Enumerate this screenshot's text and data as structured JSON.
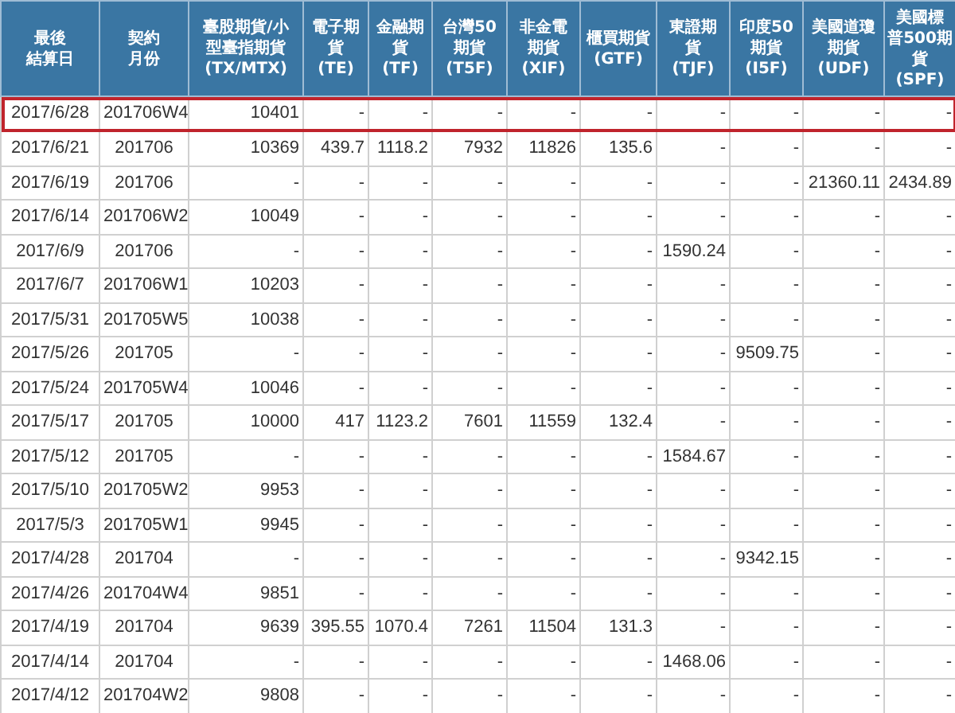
{
  "table": {
    "columns": [
      {
        "lines": [
          "最後",
          "結算日"
        ]
      },
      {
        "lines": [
          "契約",
          "月份"
        ]
      },
      {
        "lines": [
          "臺股期貨/小",
          "型臺指期貨",
          "(TX/MTX)"
        ]
      },
      {
        "lines": [
          "電子期",
          "貨",
          "(TE)"
        ]
      },
      {
        "lines": [
          "金融期",
          "貨",
          "(TF)"
        ]
      },
      {
        "lines": [
          "台灣50",
          "期貨",
          "(T5F)"
        ]
      },
      {
        "lines": [
          "非金電",
          "期貨",
          "(XIF)"
        ]
      },
      {
        "lines": [
          "櫃買期貨",
          "(GTF)"
        ]
      },
      {
        "lines": [
          "東證期",
          "貨",
          "(TJF)"
        ]
      },
      {
        "lines": [
          "印度50",
          "期貨",
          "(I5F)"
        ]
      },
      {
        "lines": [
          "美國道瓊",
          "期貨",
          "(UDF)"
        ]
      },
      {
        "lines": [
          "美國標",
          "普500期",
          "貨",
          "(SPF)"
        ]
      }
    ],
    "rows": [
      {
        "selected": true,
        "cells": [
          "2017/6/28",
          "201706W4",
          "10401",
          "-",
          "-",
          "-",
          "-",
          "-",
          "-",
          "-",
          "-",
          "-"
        ]
      },
      {
        "selected": false,
        "cells": [
          "2017/6/21",
          "201706",
          "10369",
          "439.7",
          "1118.2",
          "7932",
          "11826",
          "135.6",
          "-",
          "-",
          "-",
          "-"
        ]
      },
      {
        "selected": false,
        "cells": [
          "2017/6/19",
          "201706",
          "-",
          "-",
          "-",
          "-",
          "-",
          "-",
          "-",
          "-",
          "21360.11",
          "2434.89"
        ]
      },
      {
        "selected": false,
        "cells": [
          "2017/6/14",
          "201706W2",
          "10049",
          "-",
          "-",
          "-",
          "-",
          "-",
          "-",
          "-",
          "-",
          "-"
        ]
      },
      {
        "selected": false,
        "cells": [
          "2017/6/9",
          "201706",
          "-",
          "-",
          "-",
          "-",
          "-",
          "-",
          "1590.24",
          "-",
          "-",
          "-"
        ]
      },
      {
        "selected": false,
        "cells": [
          "2017/6/7",
          "201706W1",
          "10203",
          "-",
          "-",
          "-",
          "-",
          "-",
          "-",
          "-",
          "-",
          "-"
        ]
      },
      {
        "selected": false,
        "cells": [
          "2017/5/31",
          "201705W5",
          "10038",
          "-",
          "-",
          "-",
          "-",
          "-",
          "-",
          "-",
          "-",
          "-"
        ]
      },
      {
        "selected": false,
        "cells": [
          "2017/5/26",
          "201705",
          "-",
          "-",
          "-",
          "-",
          "-",
          "-",
          "-",
          "9509.75",
          "-",
          "-"
        ]
      },
      {
        "selected": false,
        "cells": [
          "2017/5/24",
          "201705W4",
          "10046",
          "-",
          "-",
          "-",
          "-",
          "-",
          "-",
          "-",
          "-",
          "-"
        ]
      },
      {
        "selected": false,
        "cells": [
          "2017/5/17",
          "201705",
          "10000",
          "417",
          "1123.2",
          "7601",
          "11559",
          "132.4",
          "-",
          "-",
          "-",
          "-"
        ]
      },
      {
        "selected": false,
        "cells": [
          "2017/5/12",
          "201705",
          "-",
          "-",
          "-",
          "-",
          "-",
          "-",
          "1584.67",
          "-",
          "-",
          "-"
        ]
      },
      {
        "selected": false,
        "cells": [
          "2017/5/10",
          "201705W2",
          "9953",
          "-",
          "-",
          "-",
          "-",
          "-",
          "-",
          "-",
          "-",
          "-"
        ]
      },
      {
        "selected": false,
        "cells": [
          "2017/5/3",
          "201705W1",
          "9945",
          "-",
          "-",
          "-",
          "-",
          "-",
          "-",
          "-",
          "-",
          "-"
        ]
      },
      {
        "selected": false,
        "cells": [
          "2017/4/28",
          "201704",
          "-",
          "-",
          "-",
          "-",
          "-",
          "-",
          "-",
          "9342.15",
          "-",
          "-"
        ]
      },
      {
        "selected": false,
        "cells": [
          "2017/4/26",
          "201704W4",
          "9851",
          "-",
          "-",
          "-",
          "-",
          "-",
          "-",
          "-",
          "-",
          "-"
        ]
      },
      {
        "selected": false,
        "cells": [
          "2017/4/19",
          "201704",
          "9639",
          "395.55",
          "1070.4",
          "7261",
          "11504",
          "131.3",
          "-",
          "-",
          "-",
          "-"
        ]
      },
      {
        "selected": false,
        "cells": [
          "2017/4/14",
          "201704",
          "-",
          "-",
          "-",
          "-",
          "-",
          "-",
          "1468.06",
          "-",
          "-",
          "-"
        ]
      },
      {
        "selected": false,
        "cells": [
          "2017/4/12",
          "201704W2",
          "9808",
          "-",
          "-",
          "-",
          "-",
          "-",
          "-",
          "-",
          "-",
          "-"
        ]
      }
    ]
  }
}
